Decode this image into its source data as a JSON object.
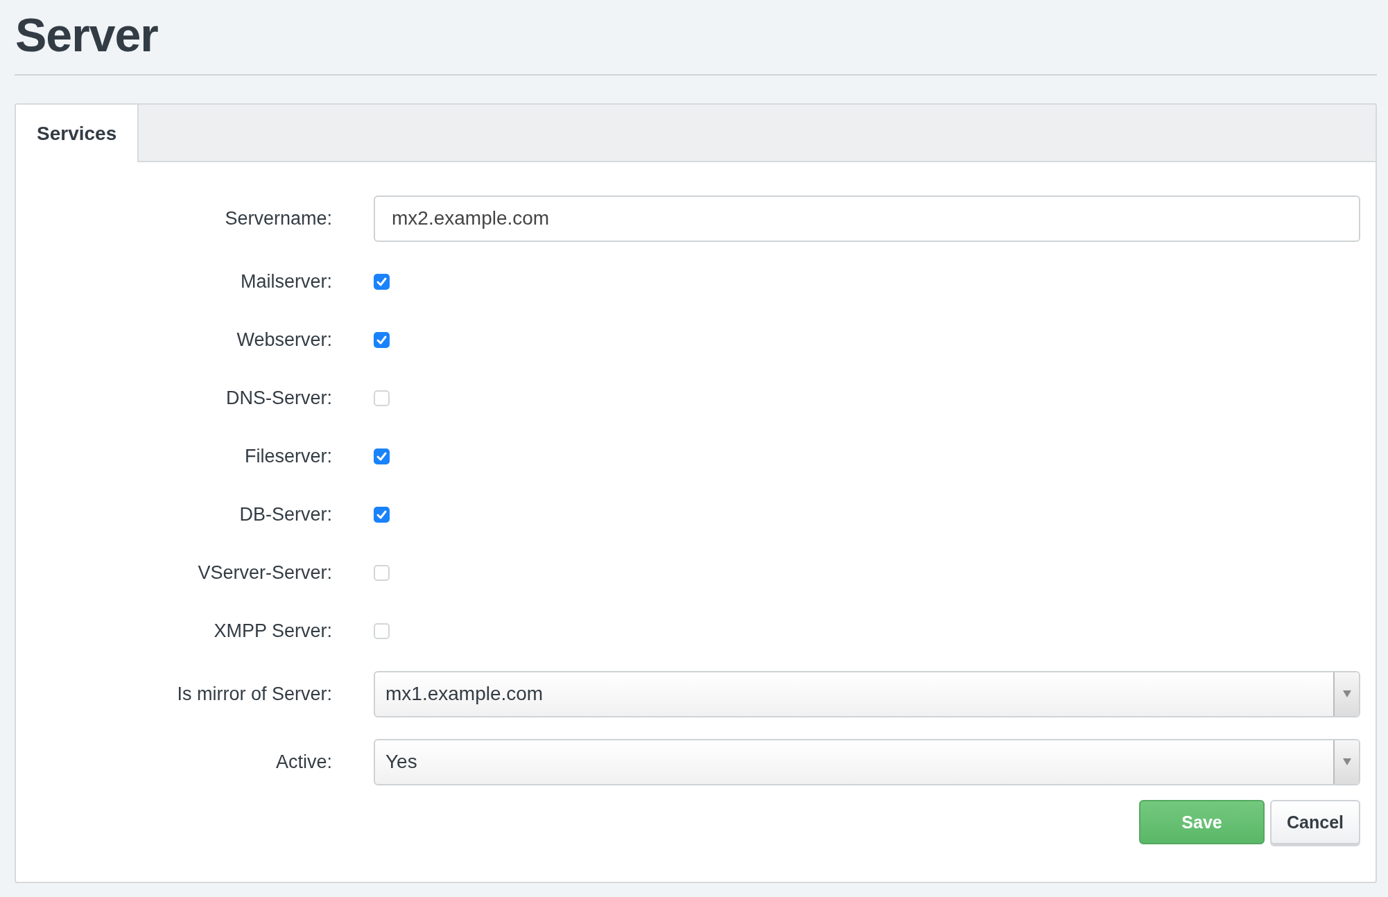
{
  "page_title": "Server",
  "tabs": [
    {
      "label": "Services",
      "selected": true
    }
  ],
  "fields": [
    {
      "kind": "text",
      "label": "Servername:",
      "value": "mx2.example.com"
    },
    {
      "kind": "checkbox",
      "label": "Mailserver:",
      "checked": true
    },
    {
      "kind": "checkbox",
      "label": "Webserver:",
      "checked": true
    },
    {
      "kind": "checkbox",
      "label": "DNS-Server:",
      "checked": false
    },
    {
      "kind": "checkbox",
      "label": "Fileserver:",
      "checked": true
    },
    {
      "kind": "checkbox",
      "label": "DB-Server:",
      "checked": true
    },
    {
      "kind": "checkbox",
      "label": "VServer-Server:",
      "checked": false
    },
    {
      "kind": "checkbox",
      "label": "XMPP Server:",
      "checked": false
    },
    {
      "kind": "select",
      "label": "Is mirror of Server:",
      "value": "mx1.example.com"
    },
    {
      "kind": "select",
      "label": "Active:",
      "value": "Yes"
    }
  ],
  "buttons": [
    {
      "kind": "primary",
      "label": "Save"
    },
    {
      "kind": "default",
      "label": "Cancel"
    }
  ]
}
